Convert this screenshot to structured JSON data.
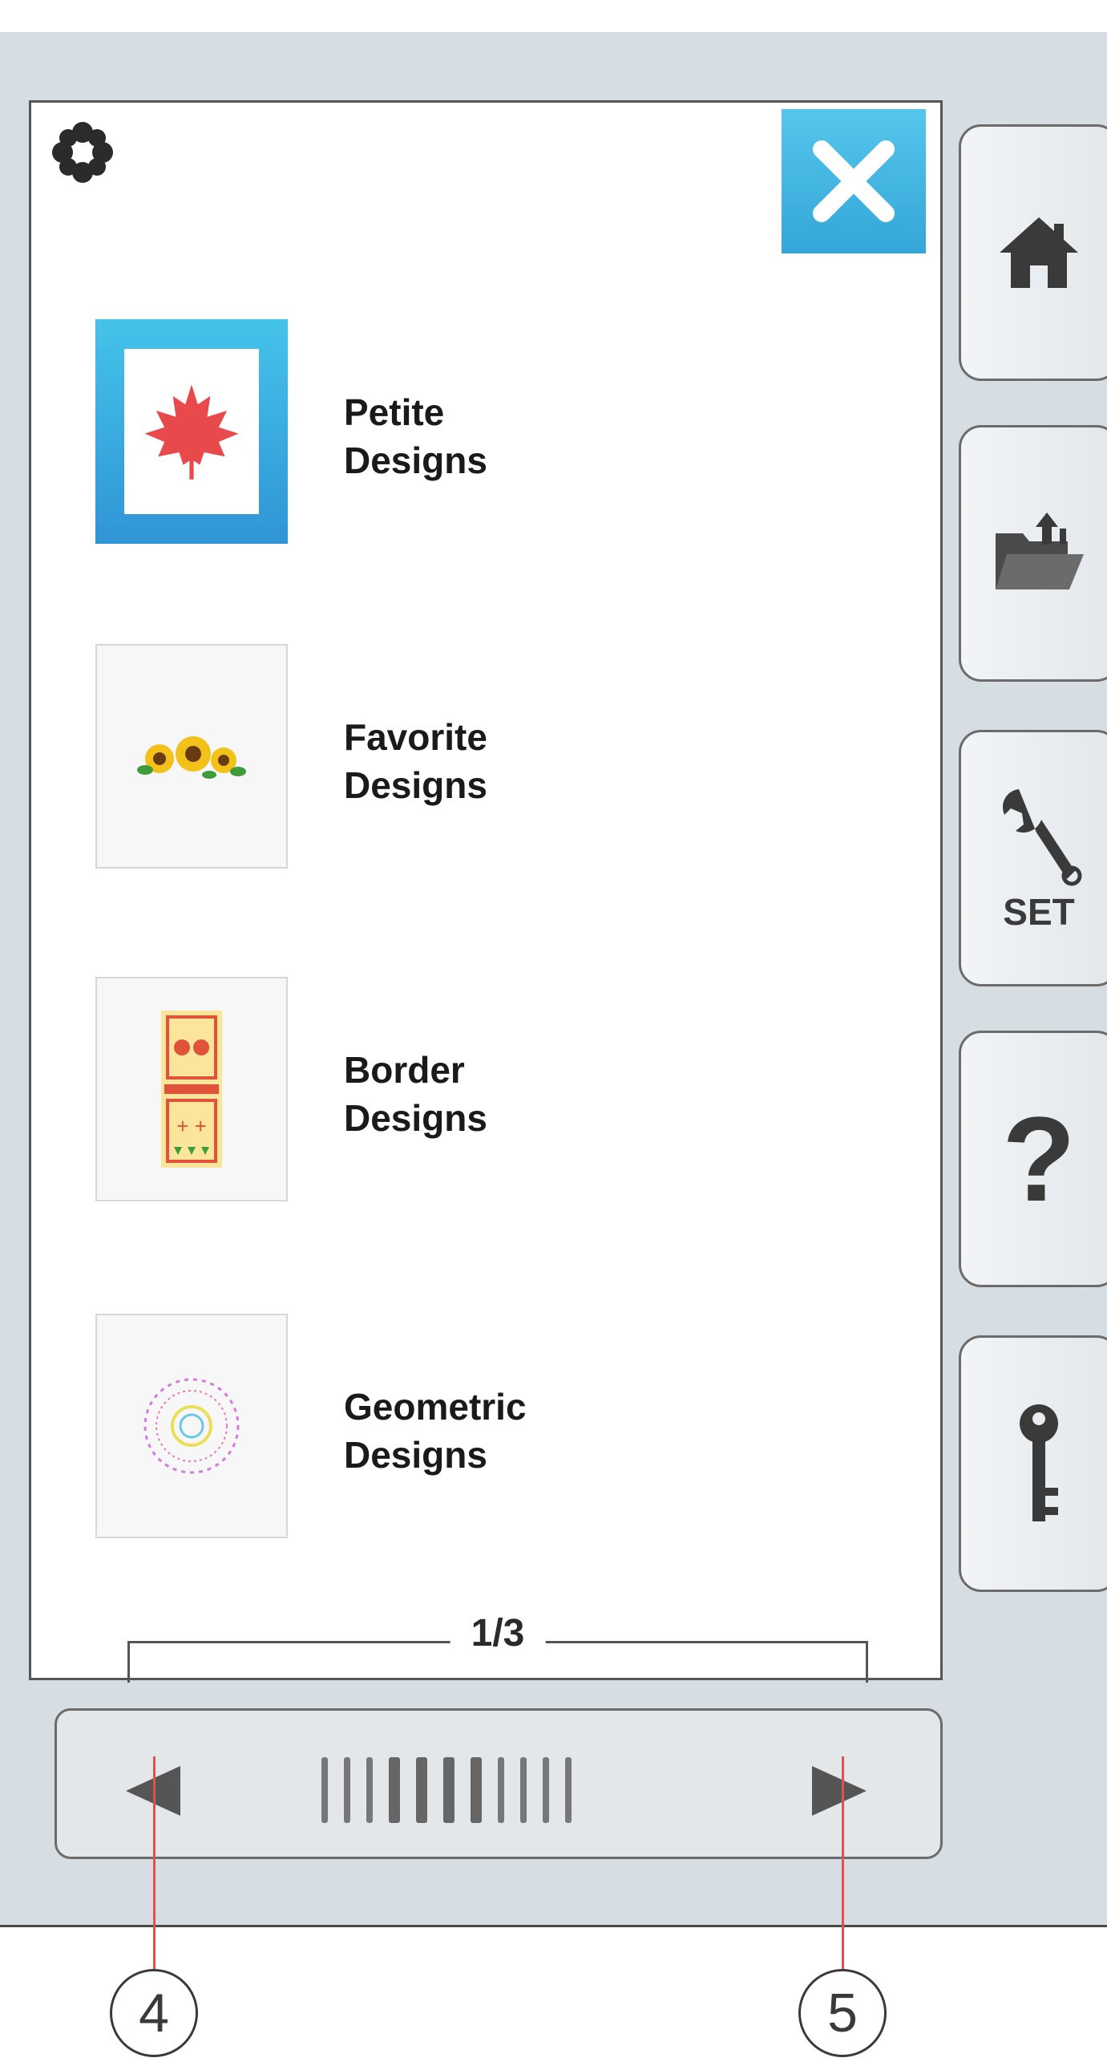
{
  "window": {
    "close_icon": "close-icon",
    "menu_icon": "flower-icon"
  },
  "categories": [
    {
      "label_line1": "Petite",
      "label_line2": "Designs",
      "selected": true,
      "icon": "maple-leaf-icon"
    },
    {
      "label_line1": "Favorite",
      "label_line2": "Designs",
      "selected": false,
      "icon": "sunflower-icon"
    },
    {
      "label_line1": "Border",
      "label_line2": "Designs",
      "selected": false,
      "icon": "border-pattern-icon"
    },
    {
      "label_line1": "Geometric",
      "label_line2": "Designs",
      "selected": false,
      "icon": "geometric-circle-icon"
    }
  ],
  "pagination": {
    "page": "1/3"
  },
  "sidebar": [
    {
      "icon": "home-icon"
    },
    {
      "icon": "folder-upload-icon"
    },
    {
      "icon": "wrench-icon",
      "label": "SET"
    },
    {
      "icon": "question-icon",
      "label": "?"
    },
    {
      "icon": "key-icon"
    }
  ],
  "callouts": {
    "left": "4",
    "right": "5"
  },
  "colors": {
    "accent": "#3bb4e4",
    "leaf": "#e8494b",
    "panel_bg": "#d6dde3"
  }
}
